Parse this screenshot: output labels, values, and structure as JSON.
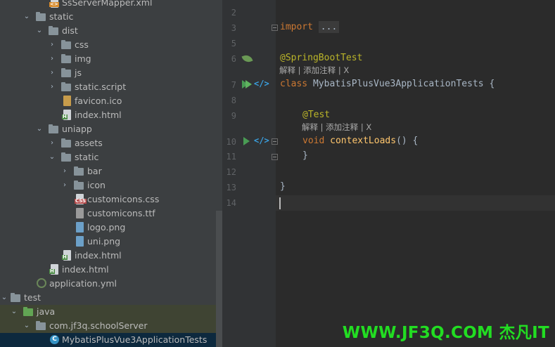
{
  "tree": {
    "items": [
      {
        "label": "SsServerMapper.xml"
      },
      {
        "label": "static"
      },
      {
        "label": "dist"
      },
      {
        "label": "css"
      },
      {
        "label": "img"
      },
      {
        "label": "js"
      },
      {
        "label": "static.script"
      },
      {
        "label": "favicon.ico"
      },
      {
        "label": "index.html"
      },
      {
        "label": "uniapp"
      },
      {
        "label": "assets"
      },
      {
        "label": "static"
      },
      {
        "label": "bar"
      },
      {
        "label": "icon"
      },
      {
        "label": "customicons.css"
      },
      {
        "label": "customicons.ttf"
      },
      {
        "label": "logo.png"
      },
      {
        "label": "uni.png"
      },
      {
        "label": "index.html"
      },
      {
        "label": "index.html"
      },
      {
        "label": "application.yml"
      },
      {
        "label": "test"
      },
      {
        "label": "java"
      },
      {
        "label": "com.jf3q.schoolServer"
      },
      {
        "label": "MybatisPlusVue3ApplicationTests"
      }
    ]
  },
  "editor": {
    "line_numbers": [
      "2",
      "3",
      "5",
      "6",
      "7",
      "8",
      "9",
      "10",
      "11",
      "12",
      "13",
      "14"
    ],
    "import_kw": "import",
    "import_fold": "...",
    "annotation_class": "@SpringBootTest",
    "hint_class": "解释 | 添加注释 | X",
    "class_kw": "class",
    "class_name": "MybatisPlusVue3ApplicationTests",
    "open_brace": "{",
    "annotation_method": "@Test",
    "hint_method": "解释 | 添加注释 | X",
    "void_kw": "void",
    "method_name": "contextLoads",
    "method_rest": "() {",
    "method_close": "}",
    "class_close": "}"
  },
  "watermark": "WWW.JF3Q.COM 杰凡IT",
  "colors": {
    "keyword": "#cc7832",
    "annotation": "#bbb529",
    "function": "#ffc66d",
    "watermark": "#22dd22"
  }
}
